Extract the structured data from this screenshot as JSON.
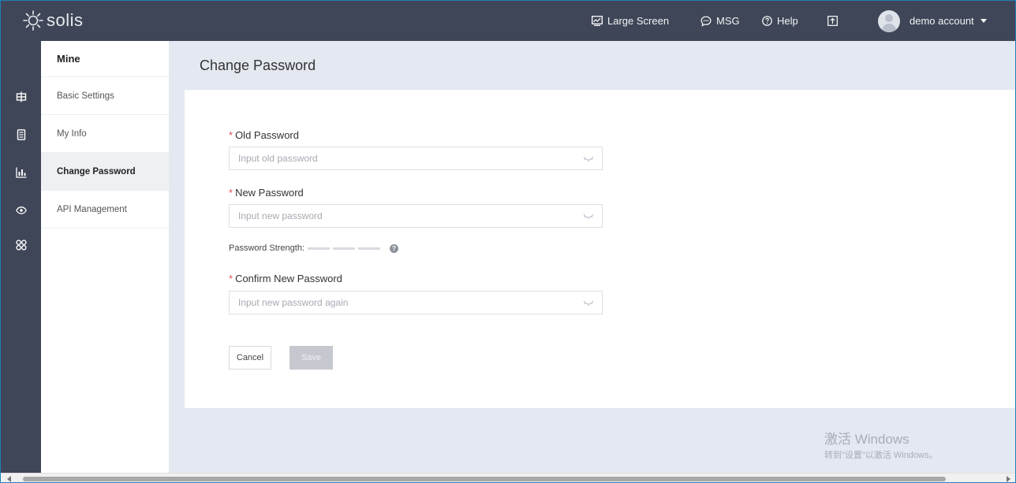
{
  "brand": {
    "name": "solis"
  },
  "topbar": {
    "large_screen": "Large Screen",
    "msg": "MSG",
    "help": "Help",
    "account": "demo account"
  },
  "rail": {
    "icons": [
      "globe-grid-icon",
      "device-icon",
      "report-chart-icon",
      "eye-icon",
      "apps-icon"
    ]
  },
  "menu": {
    "title": "Mine",
    "items": [
      {
        "label": "Basic Settings",
        "active": false
      },
      {
        "label": "My Info",
        "active": false
      },
      {
        "label": "Change Password",
        "active": true
      },
      {
        "label": "API Management",
        "active": false
      }
    ]
  },
  "page": {
    "title": "Change Password"
  },
  "form": {
    "old_password": {
      "label": "Old Password",
      "placeholder": "Input old password",
      "value": ""
    },
    "new_password": {
      "label": "New Password",
      "placeholder": "Input new password",
      "value": ""
    },
    "strength_label": "Password Strength:",
    "confirm_password": {
      "label": "Confirm New Password",
      "placeholder": "Input new password again",
      "value": ""
    },
    "required_mark": "*",
    "cancel_label": "Cancel",
    "save_label": "Save"
  },
  "watermark": {
    "line1": "激活 Windows",
    "line2": "转到\"设置\"以激活 Windows。"
  },
  "colors": {
    "topbar": "#3f4657",
    "background": "#e4e8f0",
    "required": "#e05050",
    "save_disabled": "#c5c8cf"
  }
}
